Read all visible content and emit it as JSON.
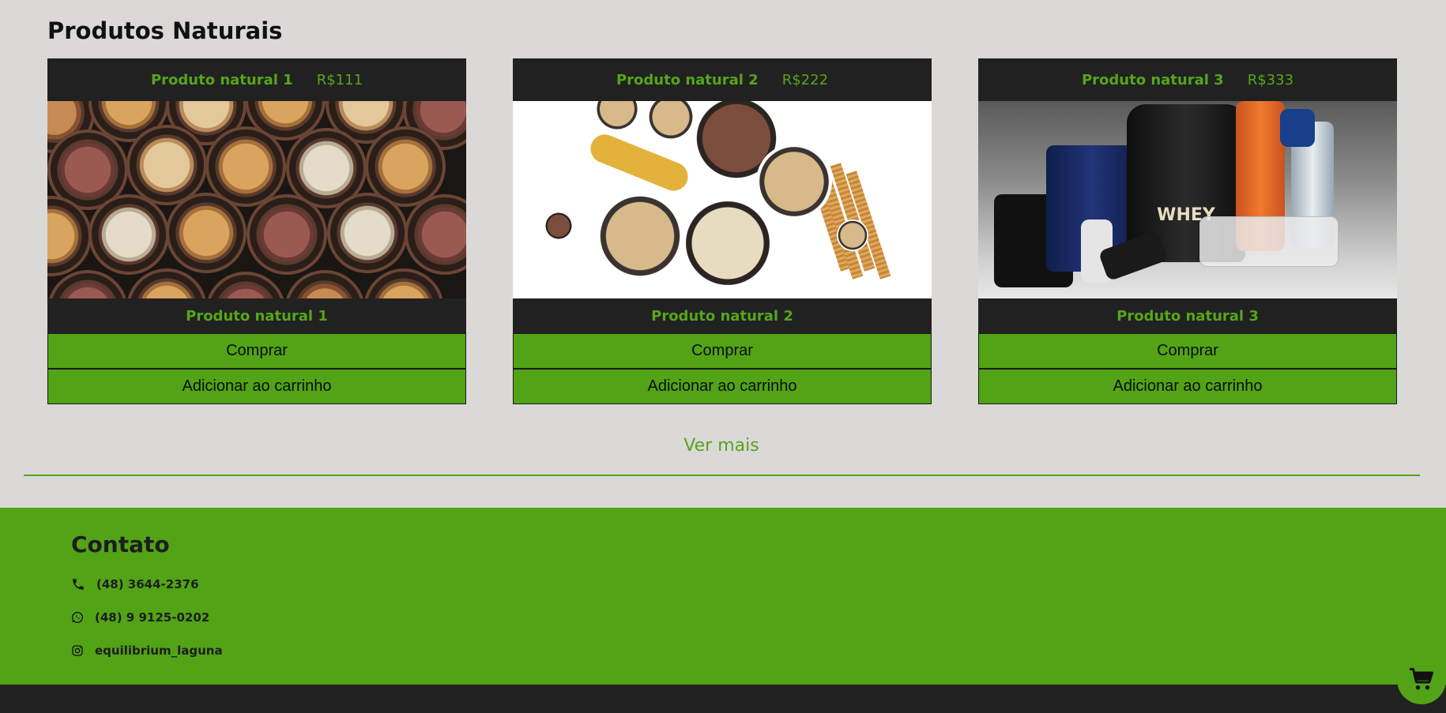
{
  "section": {
    "title": "Produtos Naturais"
  },
  "products": [
    {
      "name": "Produto natural 1",
      "price": "R$111",
      "caption": "Produto natural 1",
      "buy_label": "Comprar",
      "cart_label": "Adicionar ao carrinho"
    },
    {
      "name": "Produto natural 2",
      "price": "R$222",
      "caption": "Produto natural 2",
      "buy_label": "Comprar",
      "cart_label": "Adicionar ao carrinho"
    },
    {
      "name": "Produto natural 3",
      "price": "R$333",
      "caption": "Produto natural 3",
      "buy_label": "Comprar",
      "cart_label": "Adicionar ao carrinho",
      "image_text": "WHEY"
    }
  ],
  "see_more": "Ver mais",
  "footer": {
    "title": "Contato",
    "phone": "(48) 3644-2376",
    "whatsapp": "(48) 9 9125-0202",
    "instagram": "equilibrium_laguna"
  },
  "icons": {
    "phone": "phone-icon",
    "whatsapp": "whatsapp-icon",
    "instagram": "instagram-icon",
    "cart": "cart-icon"
  },
  "colors": {
    "accent_green": "#52a316",
    "dark": "#212121",
    "page_bg": "#dbd8d8"
  }
}
